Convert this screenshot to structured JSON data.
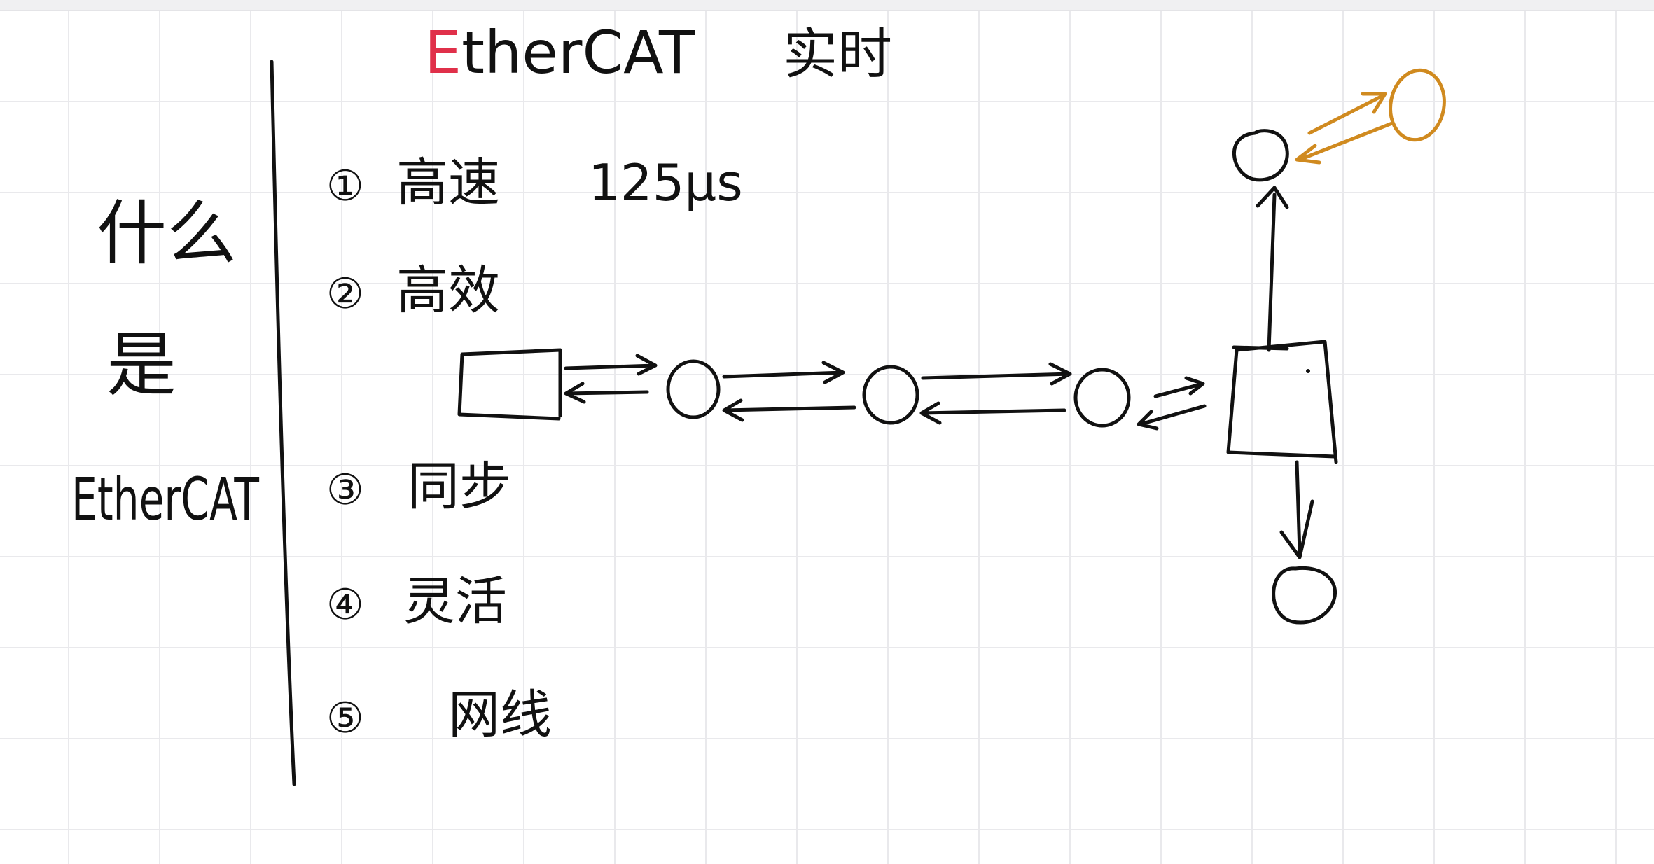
{
  "title": {
    "first_letter": "E",
    "rest": "therCAT",
    "suffix": "实时",
    "first_letter_color": "#e0304a"
  },
  "side_label": {
    "line1": "什么",
    "line2": "是",
    "line3": "EtherCAT"
  },
  "items": [
    {
      "num": "①",
      "text": "高速",
      "note": "125μs"
    },
    {
      "num": "②",
      "text": "高效",
      "note": ""
    },
    {
      "num": "③",
      "text": "同步",
      "note": ""
    },
    {
      "num": "④",
      "text": "灵活",
      "note": ""
    },
    {
      "num": "⑤",
      "text": "网线",
      "note": ""
    }
  ],
  "colors": {
    "ink": "#111111",
    "accent": "#d08a1f",
    "grid": "#e9e9ec"
  }
}
